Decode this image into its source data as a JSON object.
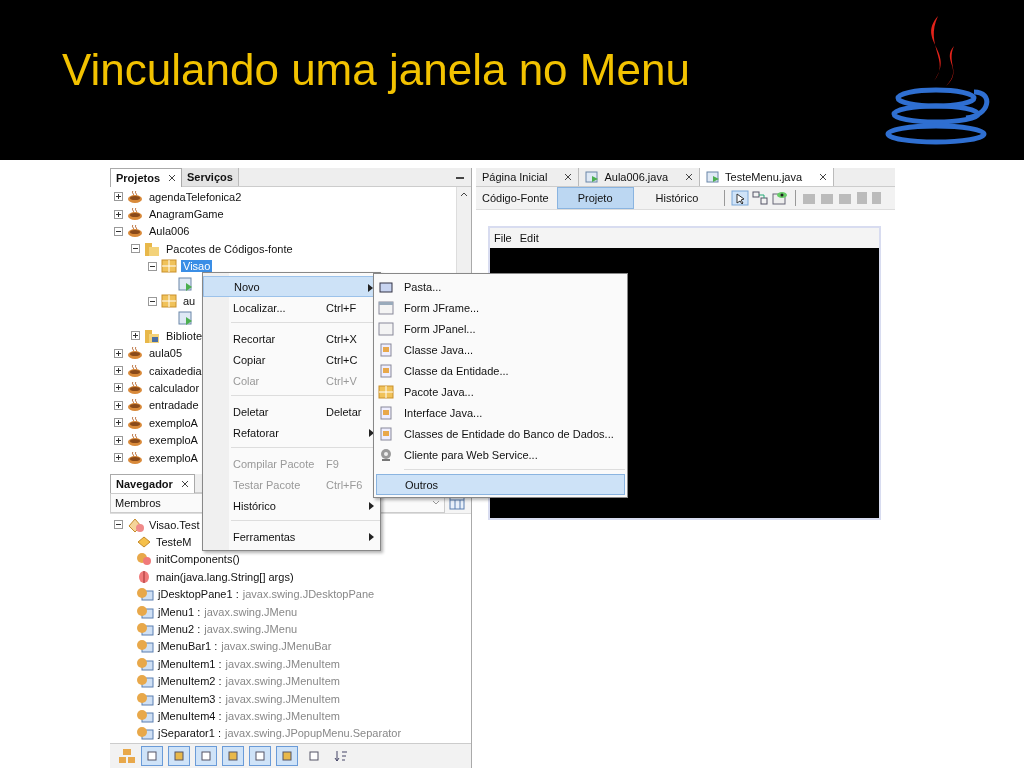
{
  "slide_title": "Vinculando uma janela no Menu",
  "projects": {
    "tabs": [
      {
        "label": "Projetos",
        "selected": true
      },
      {
        "label": "Serviços",
        "selected": false
      }
    ],
    "tree": [
      {
        "kind": "project",
        "label": "agendaTelefonica2",
        "expanded": false,
        "selected": false
      },
      {
        "kind": "project",
        "label": "AnagramGame",
        "expanded": false,
        "selected": false
      },
      {
        "kind": "project",
        "label": "Aula006",
        "expanded": true,
        "selected": false,
        "children": [
          {
            "kind": "sources",
            "label": "Pacotes de Códigos-fonte",
            "expanded": true,
            "selected": false,
            "children": [
              {
                "kind": "package",
                "label": "Visao",
                "expanded": true,
                "selected": true,
                "children": [
                  {
                    "kind": "file"
                  }
                ]
              },
              {
                "kind": "package",
                "label": "au",
                "expanded": true,
                "selected": false,
                "children": [
                  {
                    "kind": "file"
                  }
                ]
              }
            ]
          },
          {
            "kind": "library",
            "label": "Bibliote",
            "expanded": false,
            "selected": false
          }
        ]
      },
      {
        "kind": "project",
        "label": "aula05",
        "expanded": false,
        "selected": false
      },
      {
        "kind": "project",
        "label": "caixadedia",
        "expanded": false,
        "selected": false
      },
      {
        "kind": "project",
        "label": "calculador",
        "expanded": false,
        "selected": false
      },
      {
        "kind": "project",
        "label": "entradade",
        "expanded": false,
        "selected": false
      },
      {
        "kind": "project",
        "label": "exemploA",
        "expanded": false,
        "selected": false
      },
      {
        "kind": "project",
        "label": "exemploA",
        "expanded": false,
        "selected": false
      },
      {
        "kind": "project",
        "label": "exemploA",
        "expanded": false,
        "selected": false
      }
    ]
  },
  "context_menu": [
    {
      "kind": "item",
      "label": "Novo",
      "disabled": false,
      "submenu": true,
      "selected": true
    },
    {
      "kind": "item",
      "label": "Localizar...",
      "shortcut": "Ctrl+F",
      "disabled": false,
      "submenu": false,
      "selected": false
    },
    {
      "kind": "separator"
    },
    {
      "kind": "item",
      "label": "Recortar",
      "shortcut": "Ctrl+X",
      "disabled": false,
      "submenu": false,
      "selected": false
    },
    {
      "kind": "item",
      "label": "Copiar",
      "shortcut": "Ctrl+C",
      "disabled": false,
      "submenu": false,
      "selected": false
    },
    {
      "kind": "item",
      "label": "Colar",
      "shortcut": "Ctrl+V",
      "disabled": true,
      "submenu": false,
      "selected": false
    },
    {
      "kind": "separator"
    },
    {
      "kind": "item",
      "label": "Deletar",
      "shortcut": "Deletar",
      "disabled": false,
      "submenu": false,
      "selected": false
    },
    {
      "kind": "item",
      "label": "Refatorar",
      "disabled": false,
      "submenu": true,
      "selected": false
    },
    {
      "kind": "separator"
    },
    {
      "kind": "item",
      "label": "Compilar Pacote",
      "shortcut": "F9",
      "disabled": true,
      "submenu": false,
      "selected": false
    },
    {
      "kind": "item",
      "label": "Testar Pacote",
      "shortcut": "Ctrl+F6",
      "disabled": true,
      "submenu": false,
      "selected": false
    },
    {
      "kind": "item",
      "label": "Histórico",
      "disabled": false,
      "submenu": true,
      "selected": false
    },
    {
      "kind": "separator"
    },
    {
      "kind": "item",
      "label": "Ferramentas",
      "disabled": false,
      "submenu": true,
      "selected": false
    }
  ],
  "submenu": [
    {
      "kind": "folder",
      "label": "Pasta...",
      "selected": false
    },
    {
      "kind": "frame",
      "label": "Form JFrame...",
      "selected": false
    },
    {
      "kind": "panel",
      "label": "Form JPanel...",
      "selected": false
    },
    {
      "kind": "class",
      "label": "Classe Java...",
      "selected": false
    },
    {
      "kind": "class",
      "label": "Classe da Entidade...",
      "selected": false
    },
    {
      "kind": "package",
      "label": "Pacote Java...",
      "selected": false
    },
    {
      "kind": "class",
      "label": "Interface Java...",
      "selected": false
    },
    {
      "kind": "class",
      "label": "Classes de Entidade do Banco de Dados...",
      "selected": false
    },
    {
      "kind": "webservice",
      "label": "Cliente para Web Service...",
      "selected": false
    },
    {
      "kind": "separator"
    },
    {
      "kind": "none",
      "label": "Outros",
      "selected": true
    }
  ],
  "editor": {
    "tabs": [
      {
        "label": "Página Inicial",
        "icon": false,
        "selected": false
      },
      {
        "label": "Aula006.java",
        "icon": true,
        "selected": false
      },
      {
        "label": "TesteMenu.java",
        "icon": true,
        "selected": true
      }
    ],
    "views": [
      {
        "label": "Código-Fonte",
        "selected": false
      },
      {
        "label": "Projeto",
        "selected": true
      },
      {
        "label": "Histórico",
        "selected": false
      }
    ],
    "form_menu": [
      "File",
      "Edit"
    ]
  },
  "navigator": {
    "tab": "Navegador",
    "filter": "Membros",
    "root": "Visao.Test",
    "members": [
      {
        "kind": "constructor",
        "name": "TesteM"
      },
      {
        "kind": "method",
        "name": "initComponents()"
      },
      {
        "kind": "static",
        "name": "main(java.lang.String[] args)"
      },
      {
        "kind": "field",
        "name": "jDesktopPane1 :",
        "type": "javax.swing.JDesktopPane"
      },
      {
        "kind": "field",
        "name": "jMenu1 :",
        "type": "javax.swing.JMenu"
      },
      {
        "kind": "field",
        "name": "jMenu2 :",
        "type": "javax.swing.JMenu"
      },
      {
        "kind": "field",
        "name": "jMenuBar1 :",
        "type": "javax.swing.JMenuBar"
      },
      {
        "kind": "field",
        "name": "jMenuItem1 :",
        "type": "javax.swing.JMenuItem"
      },
      {
        "kind": "field",
        "name": "jMenuItem2 :",
        "type": "javax.swing.JMenuItem"
      },
      {
        "kind": "field",
        "name": "jMenuItem3 :",
        "type": "javax.swing.JMenuItem"
      },
      {
        "kind": "field",
        "name": "jMenuItem4 :",
        "type": "javax.swing.JMenuItem"
      },
      {
        "kind": "field",
        "name": "jSeparator1 :",
        "type": "javax.swing.JPopupMenu.Separator"
      }
    ],
    "filters": [
      {
        "selected": false
      },
      {
        "selected": true
      },
      {
        "selected": true
      },
      {
        "selected": true
      },
      {
        "selected": true
      },
      {
        "selected": true
      },
      {
        "selected": true
      },
      {
        "selected": false
      }
    ]
  }
}
